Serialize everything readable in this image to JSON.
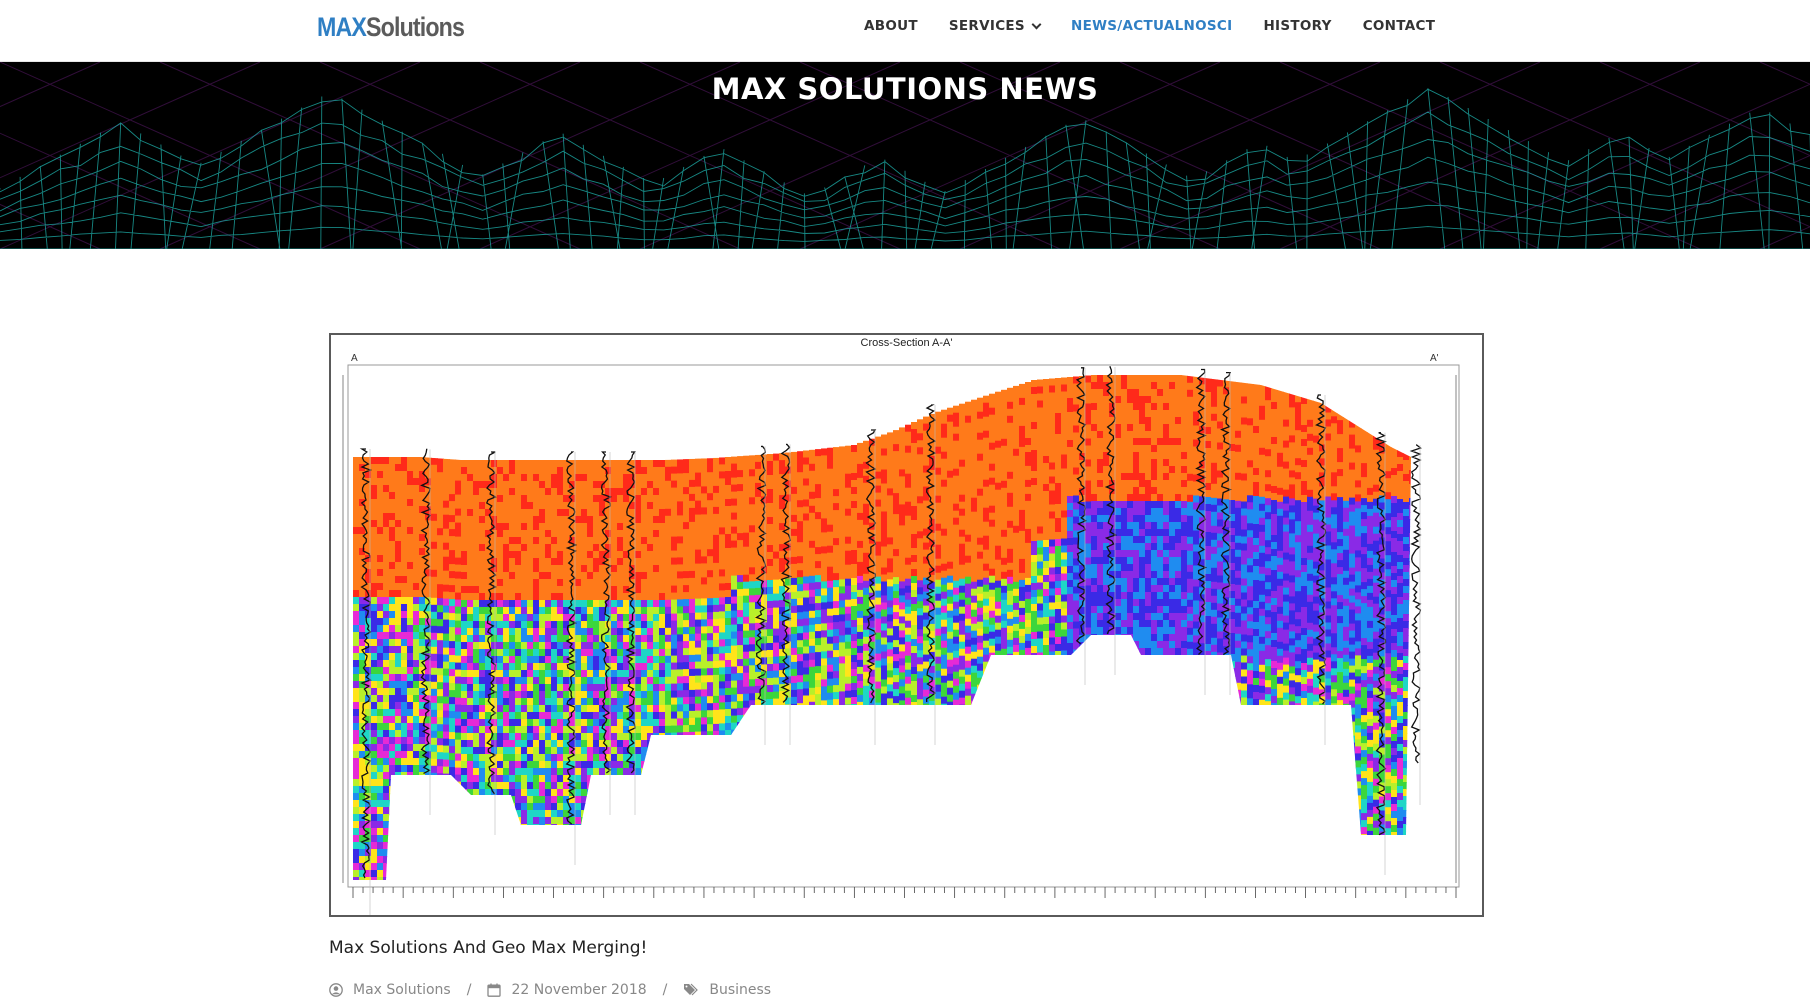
{
  "header": {
    "logo_part1": "MAX",
    "logo_part2": "Solutions",
    "nav": [
      {
        "label": "ABOUT",
        "active": false
      },
      {
        "label": "SERVICES",
        "active": false,
        "has_dropdown": true
      },
      {
        "label": "NEWS/ACTUALNOSCI",
        "active": true
      },
      {
        "label": "HISTORY",
        "active": false
      },
      {
        "label": "CONTACT",
        "active": false
      }
    ]
  },
  "hero": {
    "title": "MAX SOLUTIONS NEWS"
  },
  "figure": {
    "caption": "Cross-Section A-A'",
    "label_left": "A",
    "label_right": "A'"
  },
  "post": {
    "title": "Max Solutions And Geo Max Merging!",
    "author": "Max Solutions",
    "date": "22 November 2018",
    "category": "Business",
    "separator": "/"
  },
  "colors": {
    "accent": "#2f7fc4",
    "hero_bg": "#000000",
    "mesh": "#1fb5b0"
  }
}
